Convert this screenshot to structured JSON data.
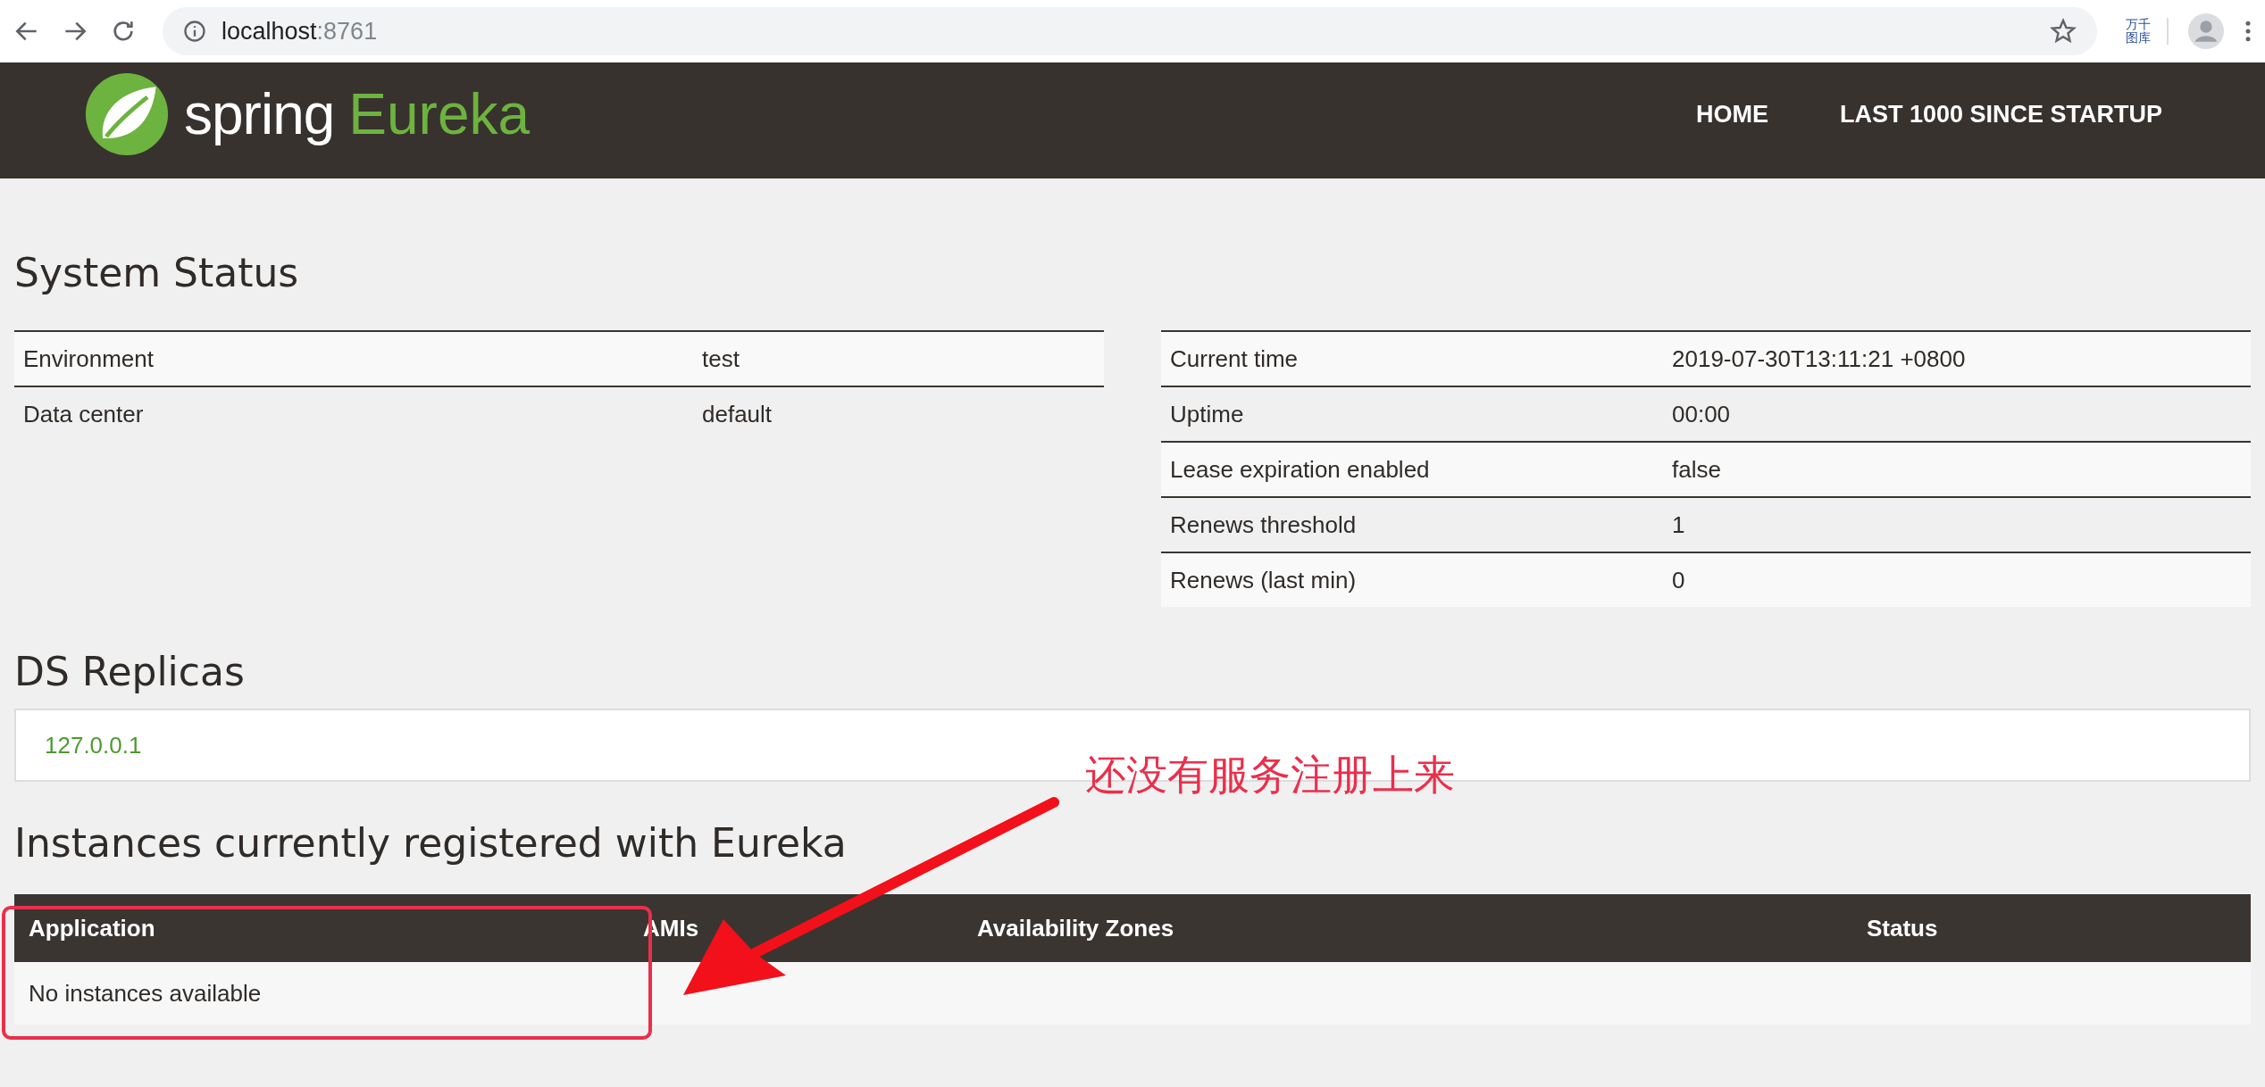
{
  "browser": {
    "url_host": "localhost",
    "url_port": ":8761",
    "extension_label": [
      "万千",
      "图库"
    ]
  },
  "nav": {
    "logo_word": "spring",
    "logo_product": "Eureka",
    "links": [
      "HOME",
      "LAST 1000 SINCE STARTUP"
    ]
  },
  "system_status": {
    "title": "System Status",
    "left_rows": [
      {
        "label": "Environment",
        "value": "test"
      },
      {
        "label": "Data center",
        "value": "default"
      }
    ],
    "right_rows": [
      {
        "label": "Current time",
        "value": "2019-07-30T13:11:21 +0800"
      },
      {
        "label": "Uptime",
        "value": "00:00"
      },
      {
        "label": "Lease expiration enabled",
        "value": "false"
      },
      {
        "label": "Renews threshold",
        "value": "1"
      },
      {
        "label": "Renews (last min)",
        "value": "0"
      }
    ]
  },
  "ds_replicas": {
    "title": "DS Replicas",
    "items": [
      "127.0.0.1"
    ]
  },
  "instances": {
    "title": "Instances currently registered with Eureka",
    "columns": [
      "Application",
      "AMIs",
      "Availability Zones",
      "Status"
    ],
    "empty_message": "No instances available"
  },
  "annotation": {
    "text": "还没有服务注册上来"
  }
}
